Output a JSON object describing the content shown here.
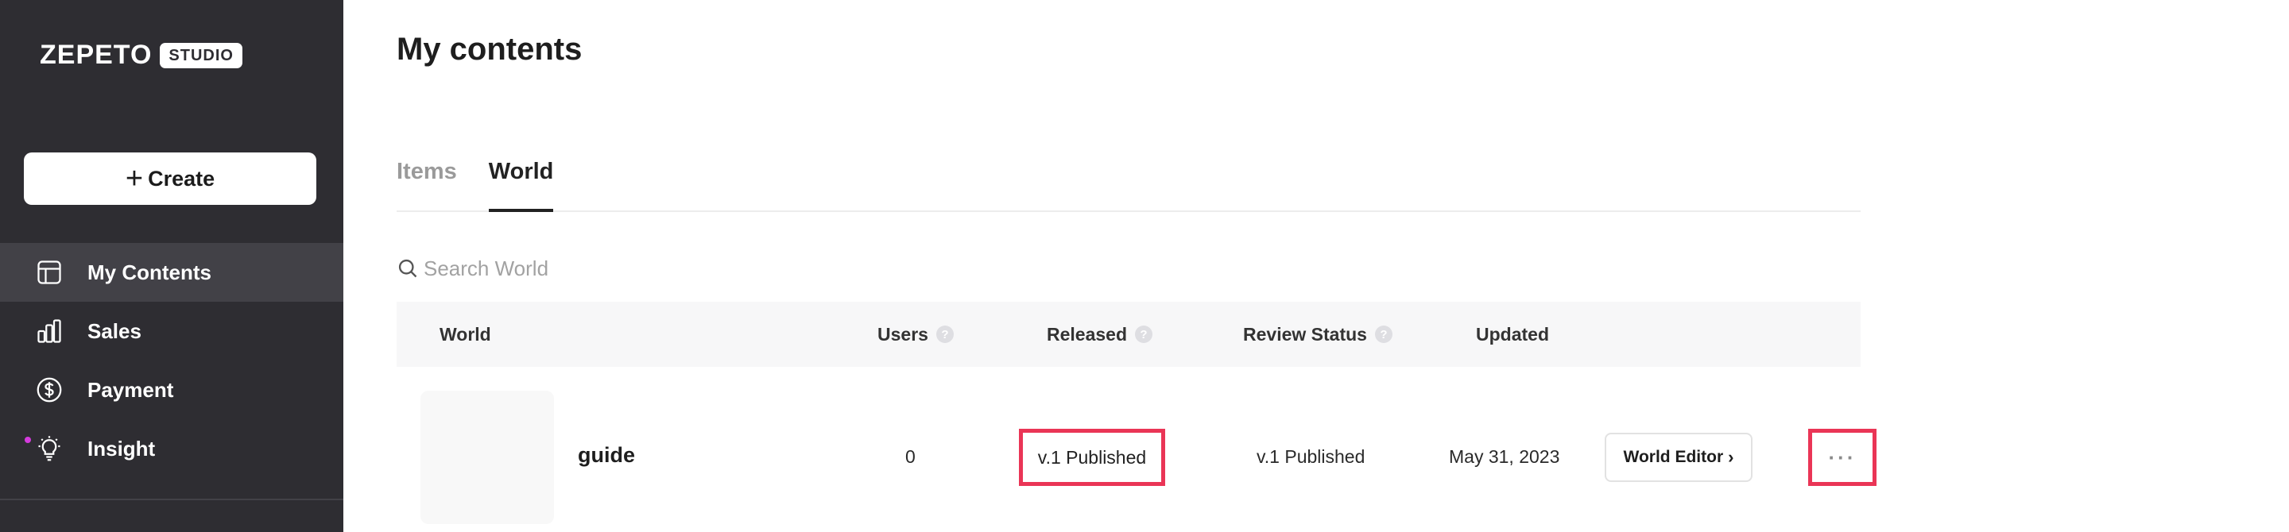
{
  "sidebar": {
    "logo_word": "ZEPETO",
    "logo_badge": "STUDIO",
    "create_label": "Create",
    "items": [
      {
        "label": "My Contents",
        "icon": "layout-icon"
      },
      {
        "label": "Sales",
        "icon": "bar-chart-icon"
      },
      {
        "label": "Payment",
        "icon": "dollar-circle-icon"
      },
      {
        "label": "Insight",
        "icon": "lightbulb-icon"
      }
    ]
  },
  "main": {
    "title": "My contents",
    "tabs": [
      {
        "label": "Items"
      },
      {
        "label": "World"
      }
    ],
    "search": {
      "placeholder": "Search World"
    },
    "table": {
      "headers": {
        "world": "World",
        "users": "Users",
        "released": "Released",
        "review_status": "Review Status",
        "updated": "Updated"
      },
      "help_glyph": "?",
      "rows": [
        {
          "name": "guide",
          "users": "0",
          "released": "v.1 Published",
          "review_status": "v.1 Published",
          "updated": "May 31, 2023",
          "editor_label": "World Editor",
          "more_glyph": "···"
        }
      ]
    }
  },
  "colors": {
    "sidebar_bg": "#2e2d32",
    "sidebar_active": "#424147",
    "highlight": "#ea3556",
    "notification_dot": "#d43bdd"
  }
}
